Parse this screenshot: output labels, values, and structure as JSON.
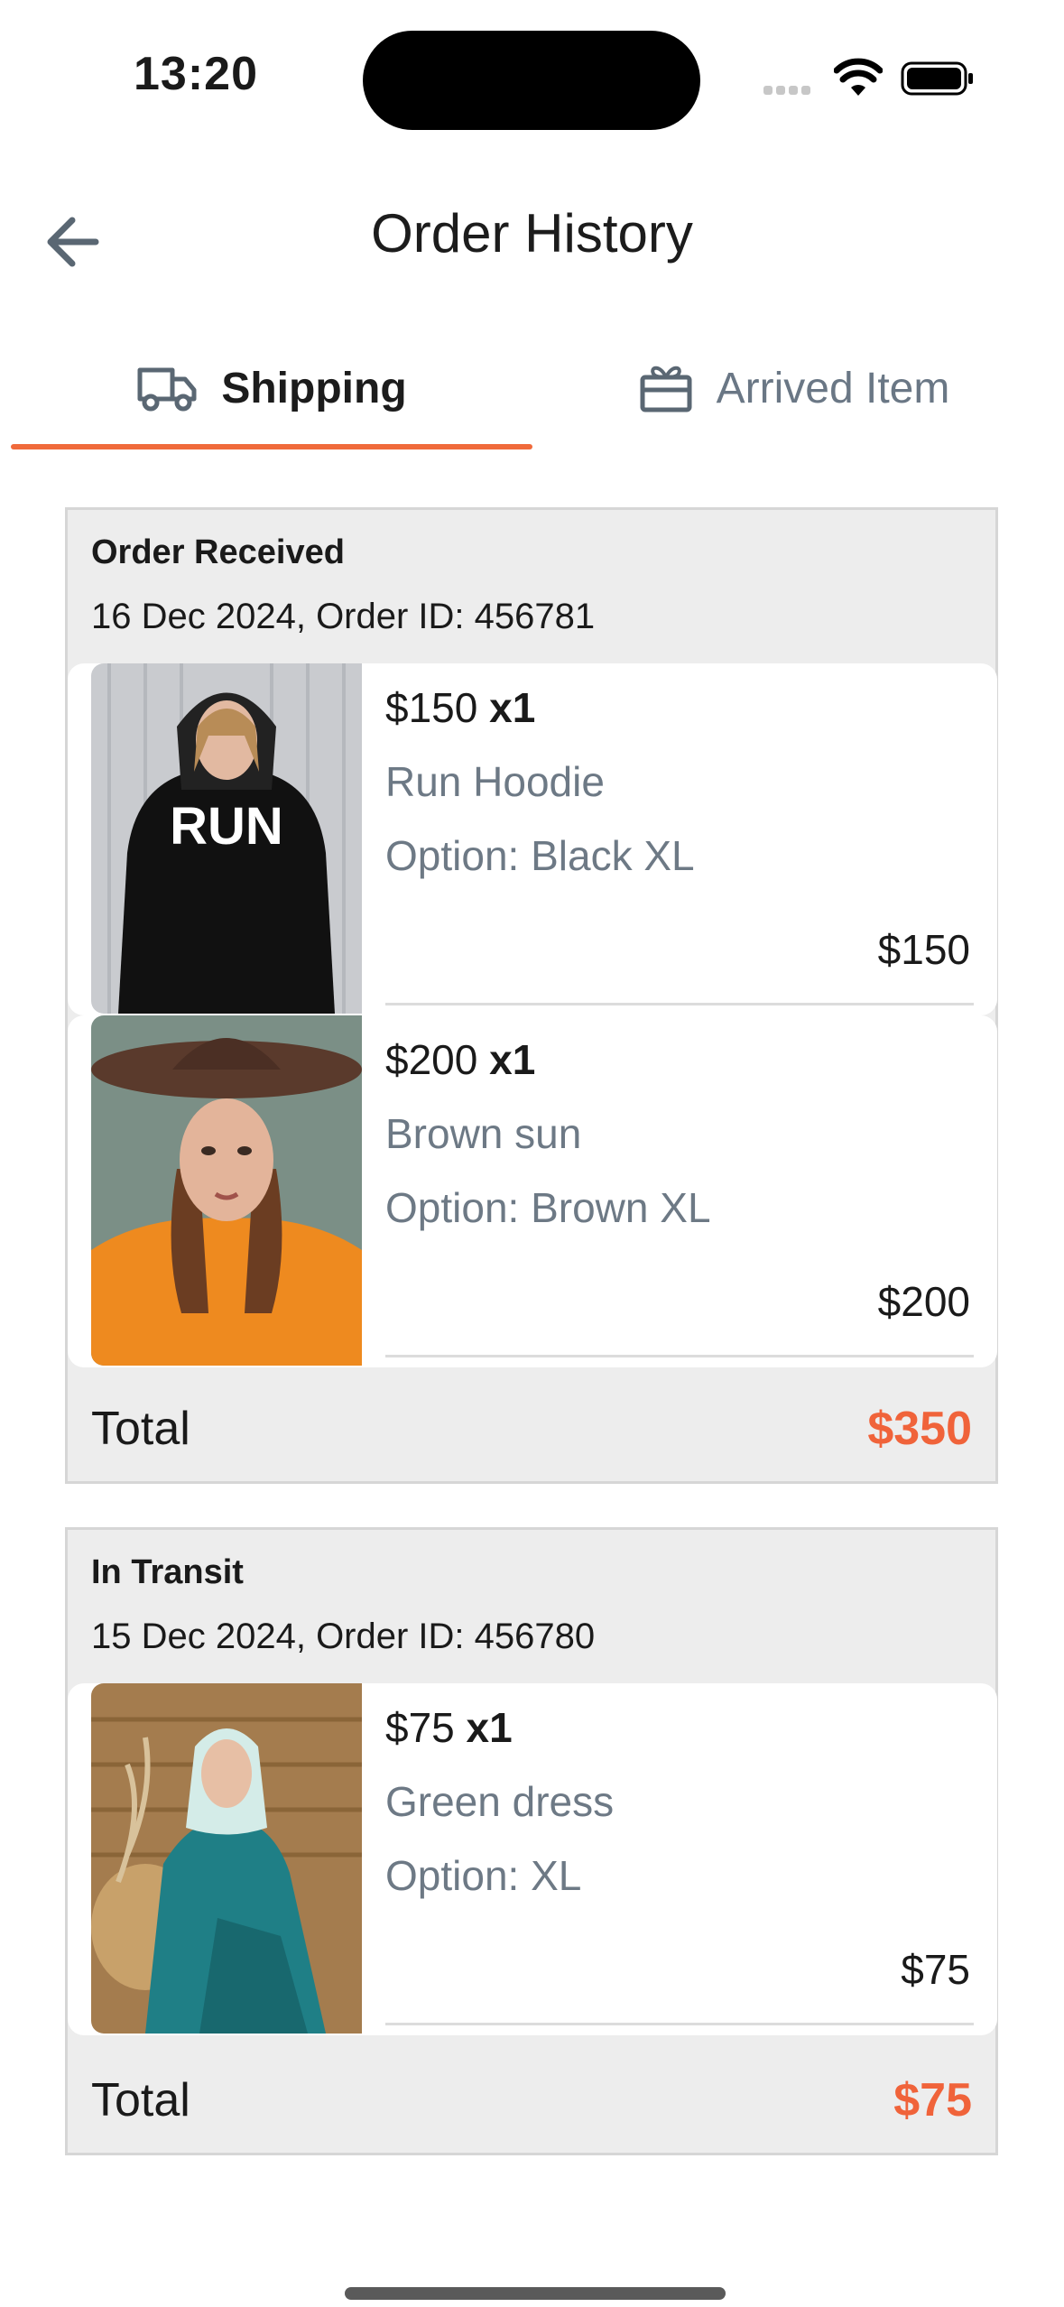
{
  "status_bar": {
    "time": "13:20"
  },
  "header": {
    "title": "Order History"
  },
  "tabs": [
    {
      "label": "Shipping",
      "icon": "truck-icon",
      "active": true
    },
    {
      "label": "Arrived Item",
      "icon": "gift-box-icon",
      "active": false
    }
  ],
  "colors": {
    "accent": "#f06a3b",
    "muted_text": "#6d7985",
    "card_bg": "#ededed"
  },
  "orders": [
    {
      "status": "Order Received",
      "meta": "16 Dec 2024, Order ID: 456781",
      "items": [
        {
          "price": "$150",
          "qty": "x1",
          "name": "Run Hoodie",
          "option": "Option: Black XL",
          "subtotal": "$150",
          "image_alt": "RUN"
        },
        {
          "price": "$200",
          "qty": "x1",
          "name": "Brown sun",
          "option": "Option: Brown XL",
          "subtotal": "$200"
        }
      ],
      "total_label": "Total",
      "total_value": "$350"
    },
    {
      "status": "In Transit",
      "meta": "15 Dec 2024, Order ID: 456780",
      "items": [
        {
          "price": "$75",
          "qty": "x1",
          "name": "Green dress",
          "option": "Option: XL",
          "subtotal": "$75"
        }
      ],
      "total_label": "Total",
      "total_value": "$75"
    }
  ]
}
